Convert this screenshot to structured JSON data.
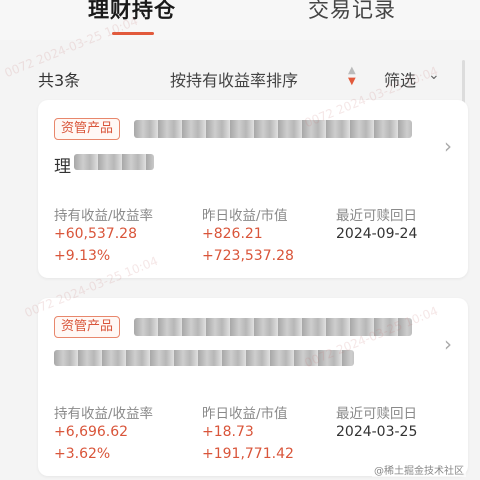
{
  "tabs": {
    "holdings": "理财持仓",
    "records": "交易记录"
  },
  "filter": {
    "count": "共3条",
    "sort_label": "按持有收益率排序",
    "filter_label": "筛选"
  },
  "colors": {
    "accent": "#d9553a",
    "muted": "#8a8a8a"
  },
  "products": [
    {
      "badge": "资管产品",
      "name_visible": "理",
      "holding_profit_label": "持有收益/收益率",
      "yesterday_label": "昨日收益/市值",
      "redeem_label": "最近可赎回日",
      "holding_profit": "+60,537.28",
      "holding_rate": "+9.13%",
      "yesterday_profit": "+826.21",
      "market_value": "+723,537.28",
      "redeem_date": "2024-09-24"
    },
    {
      "badge": "资管产品",
      "holding_profit_label": "持有收益/收益率",
      "yesterday_label": "昨日收益/市值",
      "redeem_label": "最近可赎回日",
      "holding_profit": "+6,696.62",
      "holding_rate": "+3.62%",
      "yesterday_profit": "+18.73",
      "market_value": "+191,771.42",
      "redeem_date": "2024-03-25"
    }
  ],
  "watermark": "0072 2024-03-25 10:04",
  "corner_watermark": "@稀土掘金技术社区"
}
